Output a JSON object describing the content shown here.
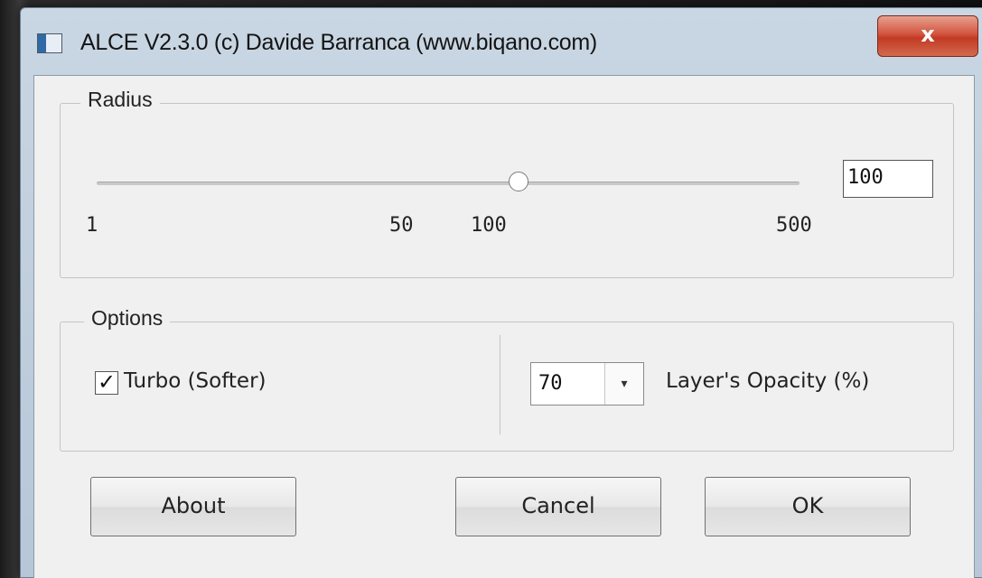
{
  "window": {
    "title": "ALCE V2.3.0 (c) Davide Barranca (www.biqano.com)",
    "close_label": "x"
  },
  "radius": {
    "legend": "Radius",
    "slider_fraction": 0.6,
    "ticks": [
      "1",
      "50",
      "100",
      "500"
    ],
    "value": "100"
  },
  "options": {
    "legend": "Options",
    "turbo_checked": true,
    "turbo_label": "Turbo (Softer)",
    "opacity_value": "70",
    "opacity_label": "Layer's Opacity (%)"
  },
  "buttons": {
    "about": "About",
    "cancel": "Cancel",
    "ok": "OK"
  },
  "icons": {
    "app": "app-icon",
    "check": "✓",
    "dropdown": "▾"
  }
}
